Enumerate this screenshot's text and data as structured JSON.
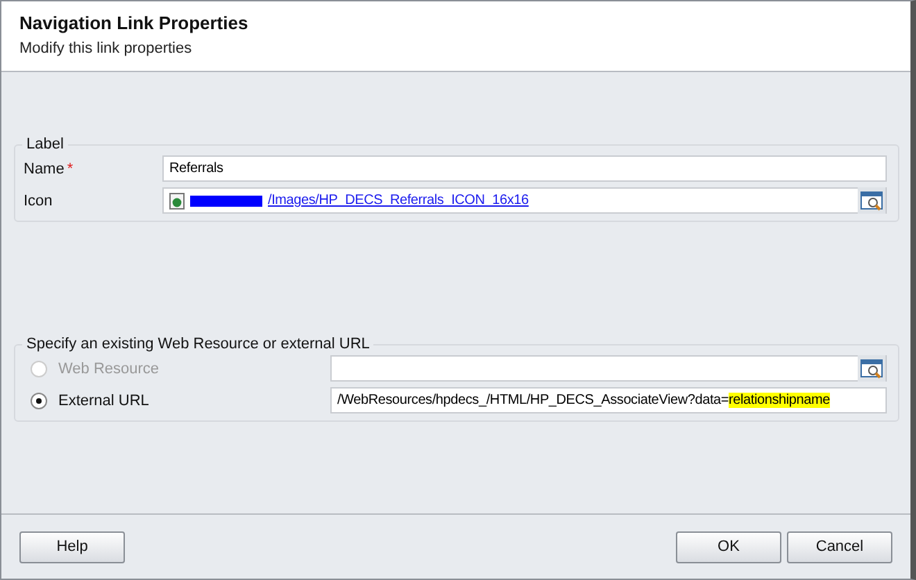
{
  "header": {
    "title": "Navigation Link Properties",
    "subtitle": "Modify this link properties"
  },
  "label_section": {
    "legend": "Label",
    "name": {
      "label": "Name",
      "required_mark": "*",
      "value": "Referrals"
    },
    "icon": {
      "label": "Icon",
      "link": "/Images/HP_DECS_Referrals_ICON_16x16",
      "redacted": true
    }
  },
  "url_section": {
    "legend": "Specify an existing Web Resource or external URL",
    "options": [
      {
        "label": "Web Resource",
        "selected": false,
        "disabled": true,
        "lookup": true
      },
      {
        "label": "External URL",
        "selected": true,
        "disabled": false,
        "value": "/WebResources/hpdecs_/HTML/HP_DECS_AssociateView?data=",
        "highlight": "relationshipname",
        "lookup": false
      }
    ]
  },
  "buttons": {
    "left": [
      "Help"
    ],
    "right": [
      "OK",
      "Cancel"
    ]
  }
}
